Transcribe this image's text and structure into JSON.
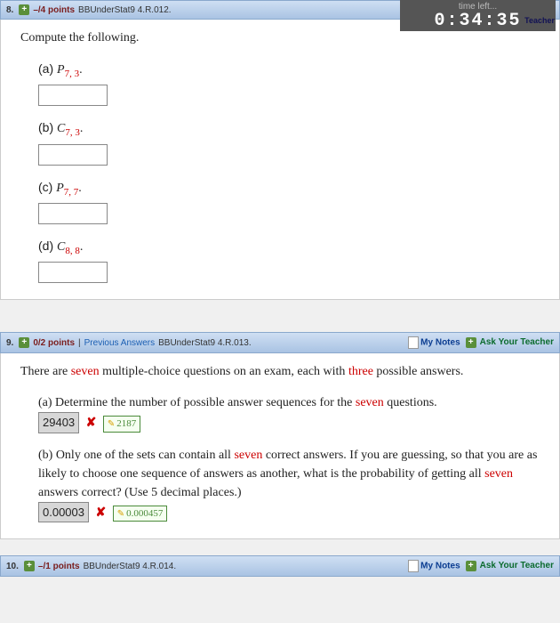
{
  "timer": {
    "label": "time left...",
    "value": "0:34:35",
    "teacher": "Teacher"
  },
  "links": {
    "mynotes": "My Notes",
    "ask": "Ask Your Teacher",
    "prev": "Previous Answers"
  },
  "q8": {
    "num": "8.",
    "points": "–/4 points",
    "src": "BBUnderStat9 4.R.012.",
    "prompt": "Compute the following.",
    "parts": {
      "a": {
        "label": "(a) ",
        "sym": "P",
        "s1": "7",
        "s2": " 3"
      },
      "b": {
        "label": "(b) ",
        "sym": "C",
        "s1": "7",
        "s2": " 3"
      },
      "c": {
        "label": "(c) ",
        "sym": "P",
        "s1": "7",
        "s2": " 7"
      },
      "d": {
        "label": "(d) ",
        "sym": "C",
        "s1": "8",
        "s2": " 8"
      }
    }
  },
  "q9": {
    "num": "9.",
    "points": "0/2 points",
    "src": "BBUnderStat9 4.R.013.",
    "intro1": "There are ",
    "seven": "seven",
    "intro2": " multiple-choice questions on an exam, each with ",
    "three": "three",
    "intro3": " possible answers.",
    "a1": "(a) Determine the number of possible answer sequences for the ",
    "a2": " questions.",
    "a_ans": "29403",
    "a_correct": "2187",
    "b1": "(b) Only one of the sets can contain all ",
    "b2": " correct answers. If you are guessing, so that you are as likely to choose one sequence of answers as another, what is the probability of getting all ",
    "b3": " answers correct? (Use 5 decimal places.)",
    "b_ans": "0.00003",
    "b_correct": "0.000457"
  },
  "q10": {
    "num": "10.",
    "points": "–/1 points",
    "src": "BBUnderStat9 4.R.014."
  }
}
